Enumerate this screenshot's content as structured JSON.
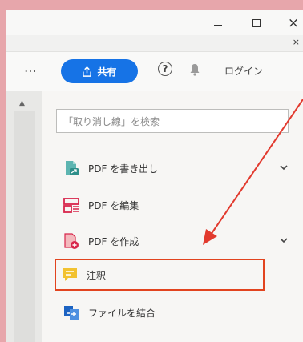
{
  "titlebar": {
    "minimize_label": "–",
    "maximize_label": "□",
    "close_label": "×"
  },
  "tabbar": {
    "tab_close_label": "×"
  },
  "toolbar": {
    "more_label": "⋯",
    "share_label": "共有",
    "help_label": "?",
    "login_label": "ログイン"
  },
  "search": {
    "placeholder": "「取り消し線」を検索"
  },
  "tools": [
    {
      "label": "PDF を書き出し",
      "icon": "export-pdf-icon",
      "has_chevron": true
    },
    {
      "label": "PDF を編集",
      "icon": "edit-pdf-icon",
      "has_chevron": false
    },
    {
      "label": "PDF を作成",
      "icon": "create-pdf-icon",
      "has_chevron": true
    },
    {
      "label": "注釈",
      "icon": "comment-icon",
      "has_chevron": false,
      "highlighted": true
    },
    {
      "label": "ファイルを結合",
      "icon": "combine-files-icon",
      "has_chevron": false
    }
  ],
  "colors": {
    "background": "#e7a6ab",
    "share_button": "#1673e6",
    "highlight_border": "#e2441f",
    "annotation_arrow": "#e23a2e"
  }
}
